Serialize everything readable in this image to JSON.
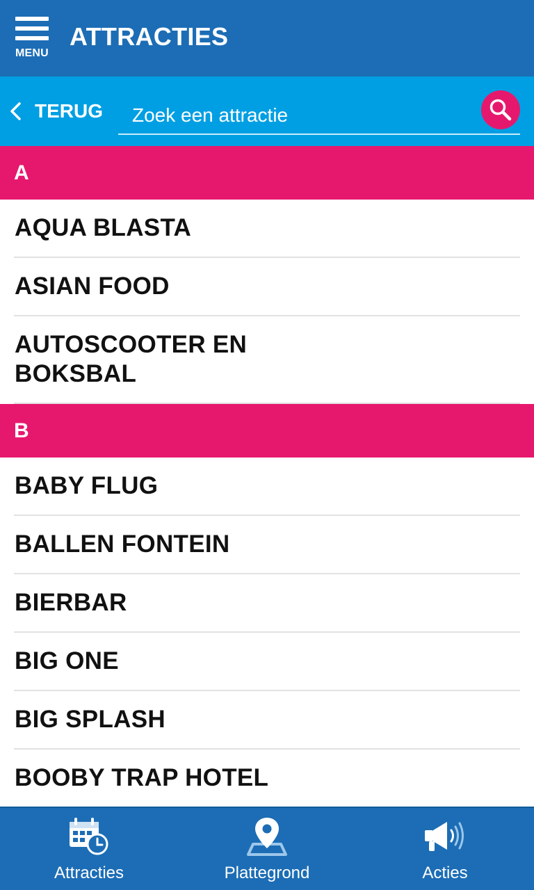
{
  "header": {
    "menu_label": "MENU",
    "title": "ATTRACTIES"
  },
  "search": {
    "back_label": "TERUG",
    "placeholder": "Zoek een attractie"
  },
  "sections": [
    {
      "letter": "A",
      "items": [
        "AQUA BLASTA",
        "ASIAN FOOD",
        "AUTOSCOOTER EN BOKSBAL"
      ]
    },
    {
      "letter": "B",
      "items": [
        "BABY FLUG",
        "BALLEN FONTEIN",
        "BIERBAR",
        "BIG ONE",
        "BIG SPLASH",
        "BOOBY TRAP HOTEL"
      ]
    }
  ],
  "bottom_nav": [
    {
      "label": "Attracties",
      "icon": "calendar-clock-icon"
    },
    {
      "label": "Plattegrond",
      "icon": "map-pin-icon"
    },
    {
      "label": "Acties",
      "icon": "megaphone-icon"
    }
  ],
  "colors": {
    "header_blue": "#1c6db5",
    "search_blue": "#009fe3",
    "accent_pink": "#e6186e"
  }
}
